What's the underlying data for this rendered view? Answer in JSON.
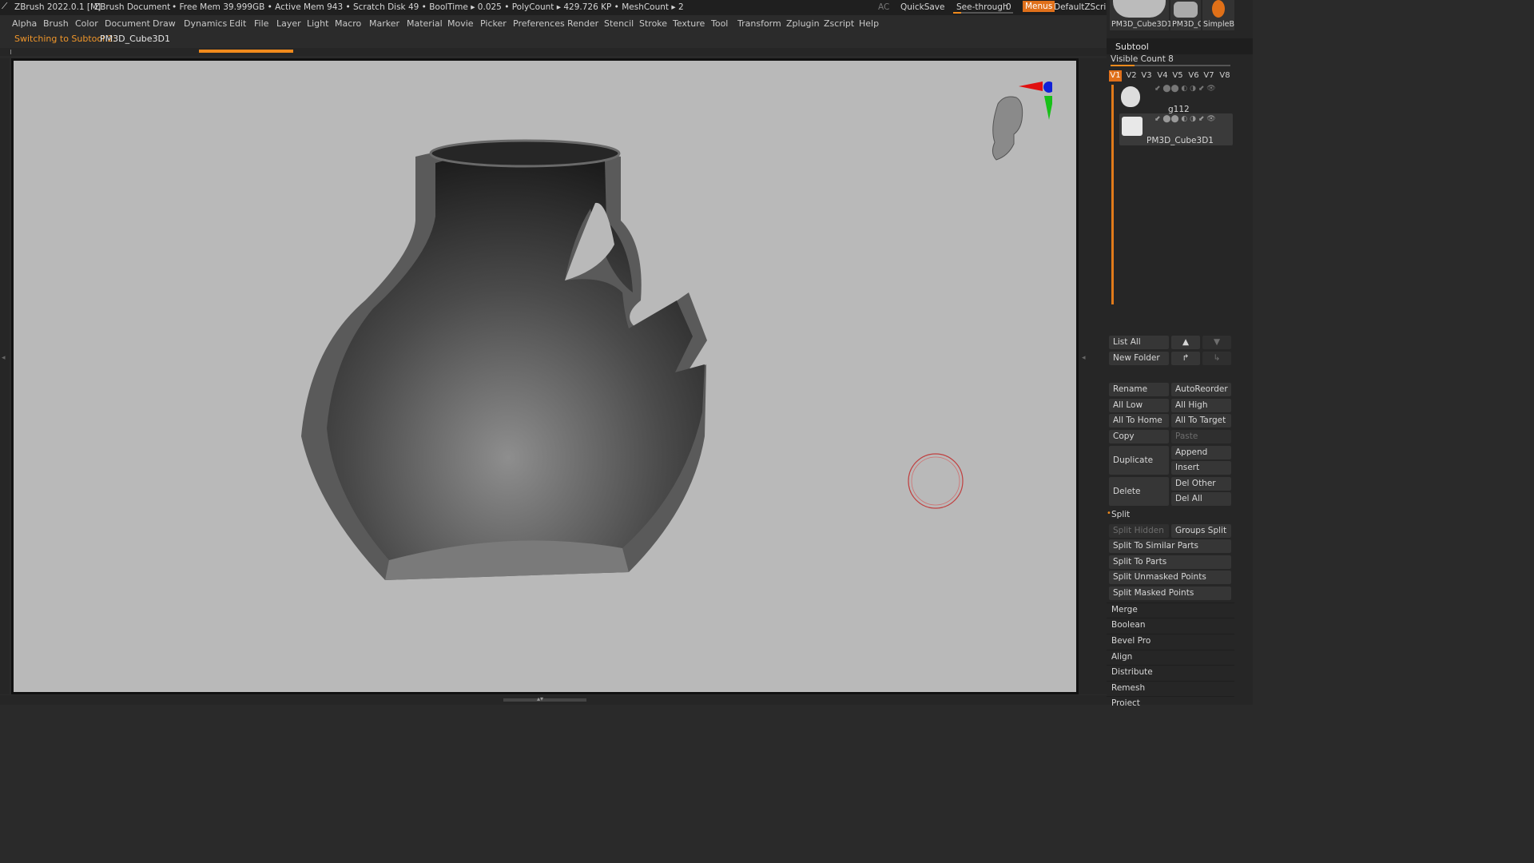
{
  "titlebar": {
    "app": "ZBrush 2022.0.1 [M]",
    "document": "ZBrush Document",
    "stats": "• Free Mem 39.999GB • Active Mem 943 • Scratch Disk 49 • BoolTime ▸ 0.025 • PolyCount ▸ 429.726 KP • MeshCount ▸ 2",
    "ac": "AC",
    "quicksave": "QuickSave",
    "seethrough": "See-through",
    "seethrough_value": "0",
    "menus": "Menus",
    "script": "DefaultZScript"
  },
  "menubar": {
    "items": [
      "Alpha",
      "Brush",
      "Color",
      "Document",
      "Draw",
      "Dynamics",
      "Edit",
      "File",
      "Layer",
      "Light",
      "Macro",
      "Marker",
      "Material",
      "Movie",
      "Picker",
      "Preferences",
      "Render",
      "Stencil",
      "Stroke",
      "Texture",
      "Tool",
      "Transform",
      "Zplugin",
      "Zscript",
      "Help"
    ]
  },
  "status": {
    "prefix": "Switching to Subtool 2:",
    "name": "PM3D_Cube3D1"
  },
  "tool_thumbs": [
    "PM3D_Cube3D1",
    "PM3D_C",
    "SimpleB"
  ],
  "subtool": {
    "title": "Subtool",
    "visible_count_label": "Visible Count 8",
    "visible_count_fraction": 0.2,
    "vtabs": [
      "V1",
      "V2",
      "V3",
      "V4",
      "V5",
      "V6",
      "V7",
      "V8"
    ],
    "items": [
      {
        "name": "g112"
      },
      {
        "name": "PM3D_Cube3D1"
      }
    ],
    "buttons": {
      "list_all": "List All",
      "new_folder": "New Folder",
      "rename": "Rename",
      "auto_reorder": "AutoReorder",
      "all_low": "All Low",
      "all_high": "All High",
      "all_to_home": "All To Home",
      "all_to_target": "All To Target",
      "copy": "Copy",
      "paste": "Paste",
      "duplicate": "Duplicate",
      "append": "Append",
      "insert": "Insert",
      "delete": "Delete",
      "del_other": "Del Other",
      "del_all": "Del All"
    },
    "split": {
      "title": "Split",
      "split_hidden": "Split Hidden",
      "groups_split": "Groups Split",
      "similar": "Split To Similar Parts",
      "parts": "Split To Parts",
      "unmasked": "Split Unmasked Points",
      "masked": "Split Masked Points"
    },
    "sections": [
      "Merge",
      "Boolean",
      "Bevel Pro",
      "Align",
      "Distribute",
      "Remesh",
      "Project"
    ]
  },
  "colors": {
    "accent": "#f08a1c",
    "canvas": "#b9b9b9",
    "panel": "#262626"
  }
}
